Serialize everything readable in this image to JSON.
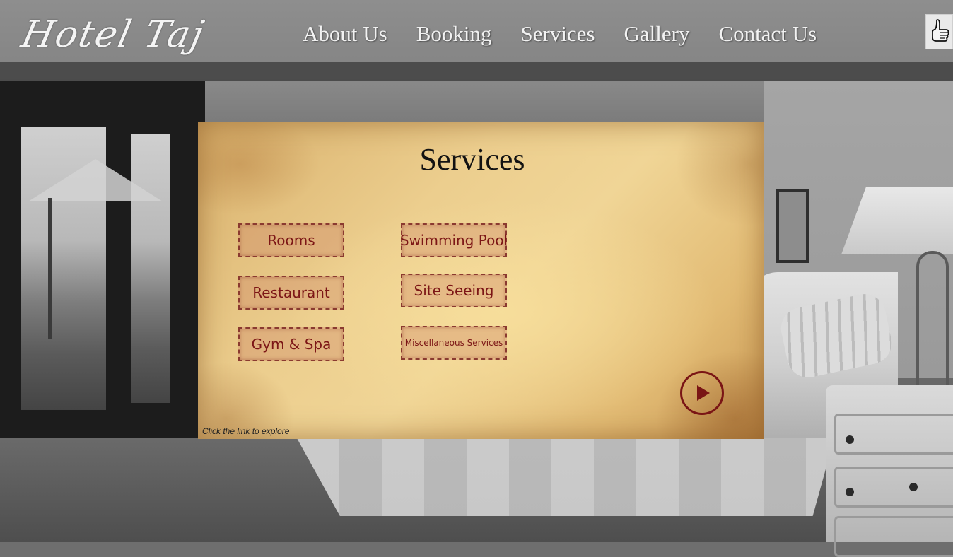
{
  "header": {
    "logo_text": "Hotel Taj",
    "nav": [
      {
        "label": "About Us"
      },
      {
        "label": "Booking"
      },
      {
        "label": "Services"
      },
      {
        "label": "Gallery"
      },
      {
        "label": "Contact Us"
      }
    ],
    "like_icon": "thumbs-up-icon"
  },
  "panel": {
    "title": "Services",
    "buttons": [
      {
        "label": "Rooms"
      },
      {
        "label": "Restaurant"
      },
      {
        "label": "Gym & Spa"
      },
      {
        "label": "Swimming Pool"
      },
      {
        "label": "Site Seeing"
      },
      {
        "label": "Miscellaneous Services"
      }
    ],
    "play_icon": "play-icon",
    "hint": "Click the link to explore"
  },
  "colors": {
    "accent": "#7a1515",
    "nav_text": "#f2f2f2",
    "parchment": "#ecce8e"
  }
}
